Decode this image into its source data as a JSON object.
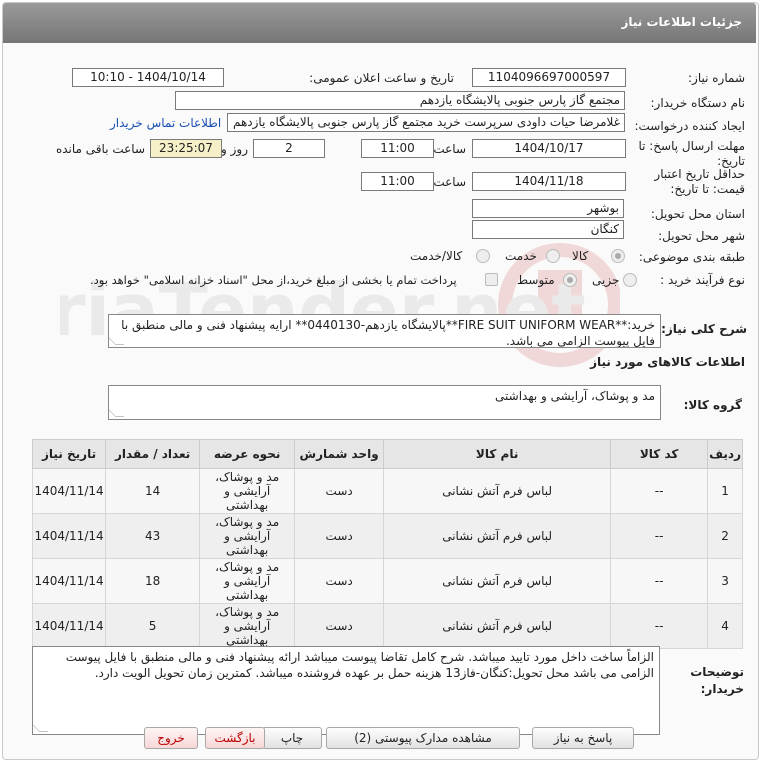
{
  "header": {
    "title": "جزئیات اطلاعات نیاز"
  },
  "fields": {
    "need_number_label": "شماره نیاز:",
    "need_number": "1104096697000597",
    "announce_label": "تاریخ و ساعت اعلان عمومی:",
    "announce_value": "1404/10/14 - 10:10",
    "buyer_org_label": "نام دستگاه خریدار:",
    "buyer_org": "مجتمع گاز پارس جنوبی  پالایشگاه یازدهم",
    "requester_label": "ایجاد کننده درخواست:",
    "requester": "غلامرضا حیات داودی سرپرست خرید مجتمع گاز پارس جنوبی  پالایشگاه یازدهم",
    "contact_link": "اطلاعات تماس خریدار",
    "deadline_label_1": "مهلت ارسال پاسخ: تا",
    "deadline_label_2": "تاریخ:",
    "deadline_date": "1404/10/17",
    "time_label": "ساعت",
    "deadline_time": "11:00",
    "days_value": "2",
    "days_label": "روز و",
    "remaining_time": "23:25:07",
    "remaining_label": "ساعت باقی مانده",
    "validity_label_1": "حداقل تاریخ اعتبار",
    "validity_label_2": "قیمت: تا تاریخ:",
    "validity_date": "1404/11/18",
    "validity_time_label": "ساعت",
    "validity_time": "11:00",
    "province_label": "استان محل تحویل:",
    "province": "بوشهر",
    "city_label": "شهر محل تحویل:",
    "city": "کنگان",
    "category_label": "طبقه بندی موضوعی:",
    "category_options": [
      "کالا",
      "خدمت",
      "کالا/خدمت"
    ],
    "process_label": "نوع فرآیند خرید :",
    "process_options": [
      "جزیی",
      "متوسط"
    ],
    "payment_note": "پرداخت تمام یا بخشی از مبلغ خرید،از محل \"اسناد خزانه اسلامی\" خواهد بود."
  },
  "description": {
    "label": "شرح کلی نیاز:",
    "text": "خرید:**FIRE SUIT UNIFORM WEAR**پالایشگاه یازدهم-0440130** ارایه پیشنهاد فنی و مالی منطبق با فایل پیوست الزامی می باشد."
  },
  "goods_info": {
    "title": "اطلاعات کالاهای مورد نیاز"
  },
  "goods_group": {
    "label": "گروه کالا:",
    "value": "مد و پوشاک، آرایشی و بهداشتی"
  },
  "table": {
    "headers": [
      "ردیف",
      "کد کالا",
      "نام کالا",
      "واحد شمارش",
      "نحوه عرضه",
      "تعداد / مقدار",
      "تاریخ نیاز"
    ],
    "rows": [
      {
        "idx": "1",
        "code": "--",
        "name": "لباس فرم آتش نشانی",
        "unit": "دست",
        "cat": "مد و پوشاک، آرایشی و بهداشتی",
        "qty": "14",
        "date": "1404/11/14"
      },
      {
        "idx": "2",
        "code": "--",
        "name": "لباس فرم آتش نشانی",
        "unit": "دست",
        "cat": "مد و پوشاک، آرایشی و بهداشتی",
        "qty": "43",
        "date": "1404/11/14"
      },
      {
        "idx": "3",
        "code": "--",
        "name": "لباس فرم آتش نشانی",
        "unit": "دست",
        "cat": "مد و پوشاک، آرایشی و بهداشتی",
        "qty": "18",
        "date": "1404/11/14"
      },
      {
        "idx": "4",
        "code": "--",
        "name": "لباس فرم آتش نشانی",
        "unit": "دست",
        "cat": "مد و پوشاک، آرایشی و بهداشتی",
        "qty": "5",
        "date": "1404/11/14"
      }
    ]
  },
  "buyer_notes": {
    "label_1": "توضیحات",
    "label_2": "خریدار:",
    "text": "الزاماً ساخت داخل مورد تایید میباشد. شرح کامل تقاضا پیوست میباشد ارائه پیشنهاد فنی و مالی منطبق با فایل پیوست الزامی می باشد محل تحویل:کنگان-فاز13 هزینه حمل بر عهده فروشنده میباشد. کمترین زمان تحویل الویت دارد."
  },
  "buttons": {
    "respond": "پاسخ به نیاز",
    "attachments": "مشاهده مدارک پیوستی (2)",
    "print": "چاپ",
    "back": "بازگشت",
    "exit": "خروج"
  },
  "watermark": {
    "text": "AriaTender.net"
  }
}
